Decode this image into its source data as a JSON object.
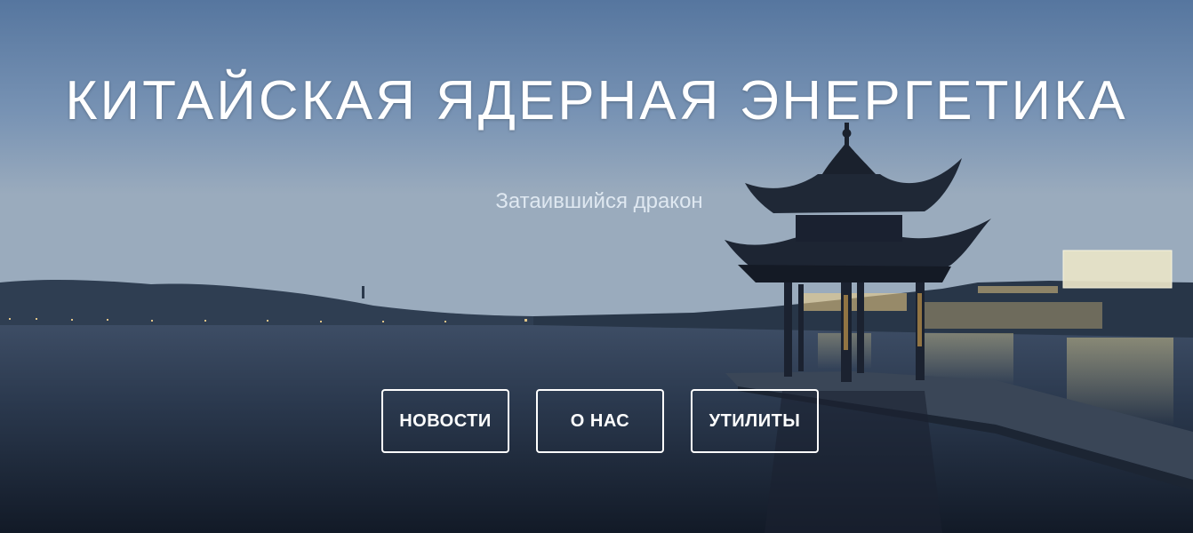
{
  "hero": {
    "title": "КИТАЙСКАЯ ЯДЕРНАЯ ЭНЕРГЕТИКА",
    "subtitle": "Затаившийся дракон",
    "background_description_icon": "lake-pagoda-image"
  },
  "nav": {
    "news_label": "НОВОСТИ",
    "about_label": "О НАС",
    "tools_label": "УТИЛИТЫ"
  },
  "colors": {
    "text": "#ffffff",
    "subtitle": "#dfe8f1",
    "sky_top": "#5f7fa8",
    "water_dark": "#141d2a"
  }
}
